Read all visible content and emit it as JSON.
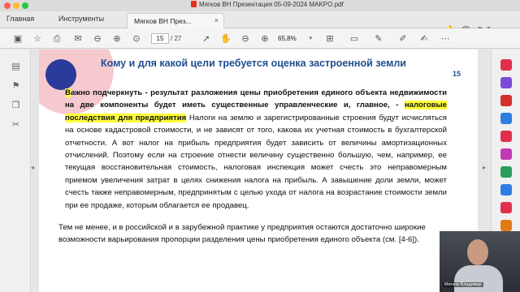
{
  "window": {
    "title": "Мягков ВН Презентация 05-09-2024 MAKPO.pdf"
  },
  "tabs": {
    "home": "Главная",
    "tools": "Инструменты",
    "document": "Мягков ВН През...",
    "close": "×",
    "signin": "Войти",
    "help": "?",
    "bell": "🔔"
  },
  "toolbar": {
    "current_page": "15",
    "total_pages": "/ 27",
    "zoom": "65,8%",
    "zoom_dropdown": "▾",
    "icons": [
      "save-icon",
      "bookmark-star-icon",
      "print-icon",
      "email-icon",
      "search-zoom-icon",
      "page-up-icon",
      "page-down-icon",
      "cursor-icon",
      "hand-icon",
      "zoom-out-icon",
      "zoom-in-icon",
      "fit-page-icon",
      "marquee-icon",
      "annotate-icon",
      "sign-icon"
    ]
  },
  "sidebar_left": {
    "icons": [
      "comment-icon",
      "bookmark-icon",
      "pages-icon",
      "attachment-icon"
    ],
    "collapse": "◂"
  },
  "sidebar_right": {
    "collapse": "▸",
    "colors": [
      "#e0304e",
      "#7b4bd6",
      "#d2302b",
      "#2f7de1",
      "#e0304e",
      "#c239b3",
      "#2a9d5c",
      "#2f7de1",
      "#e0304e",
      "#e07a16",
      "#c239b3",
      "#2f7de1"
    ]
  },
  "slide": {
    "title": "Кому и для какой цели требуется оценка застроенной земли",
    "page_number": "15",
    "para1_first_letter": "В",
    "para1_a": "ажно подчеркнуть - результат разложения цены приобретения единого объекта недвижимости на две компоненты будет иметь существенные  управленческие и, главное, - ",
    "para1_highlight": "налоговые последствия для предприятия",
    "para1_b": " Налоги на землю и зарегистрированные строения будут исчисляться на основе  кадастровой стоимости, и не зависят от того, какова  их учетная стоимость в бухгалтерской отчетности.   А вот налог на прибыль предприятия будет зависить от величины амортизационных отчислений.  Поэтому если на строение отнести величину существенно большую, чем, например, ее текущая восстановительная стоимость, налоговая инспекция может счесть это неправомерным приемом увеличения затрат в целях снижения налога на прибыль. А  завышение доли земли, может счесть также неправомерным, предпринятым с целью  ухода от налога на возрастание стоимости земли при ее продаже, которым облагается ее продавец.",
    "para2": "Тем не менее, и в российской и в зарубежной практике у предприятия остаются достаточно широкие возможности варьирования пропорции разделения цены приобретения единого объекта (см. [4-6])."
  },
  "webcam": {
    "name": "Мягков Владимир"
  }
}
